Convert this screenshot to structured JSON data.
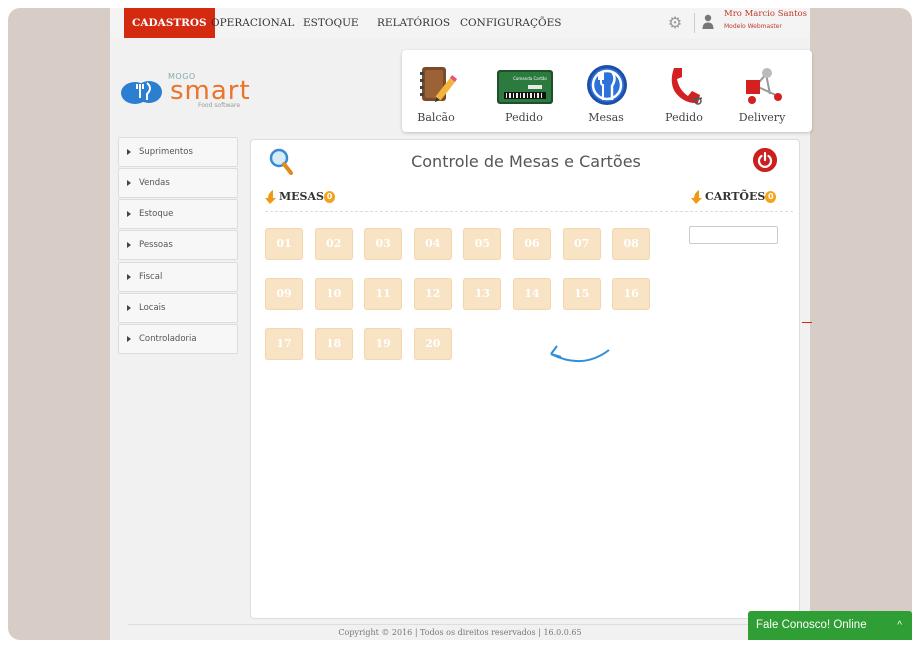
{
  "nav": {
    "items": [
      {
        "label": "CADASTROS",
        "active": true
      },
      {
        "label": "OPERACIONAL",
        "active": false
      },
      {
        "label": "ESTOQUE",
        "active": false
      },
      {
        "label": "RELATÓRIOS",
        "active": false
      },
      {
        "label": "CONFIGURAÇÕES",
        "active": false
      }
    ],
    "active_color": "#d42a0f"
  },
  "user": {
    "name": "Mro Marcio Santos",
    "role": "Modelo Webmaster"
  },
  "logo": {
    "mogo": "MOGO",
    "smart": "smart",
    "sub": "Food software"
  },
  "quick_actions": [
    {
      "label": "Balcão",
      "icon": "notebook-pencil-icon"
    },
    {
      "label": "Pedido",
      "icon": "card-icon",
      "card_text": "Comanda Cartão"
    },
    {
      "label": "Mesas",
      "icon": "fork-knife-icon"
    },
    {
      "label": "Pedido",
      "icon": "phone-icon"
    },
    {
      "label": "Delivery",
      "icon": "delivery-network-icon"
    }
  ],
  "sidebar": {
    "items": [
      {
        "label": "Suprimentos"
      },
      {
        "label": "Vendas"
      },
      {
        "label": "Estoque"
      },
      {
        "label": "Pessoas"
      },
      {
        "label": "Fiscal"
      },
      {
        "label": "Locais"
      },
      {
        "label": "Controladoria"
      }
    ]
  },
  "panel": {
    "title": "Controle de Mesas e Cartões",
    "mesas_label": "MESAS",
    "mesas_count": "0",
    "cartoes_label": "CARTÕES",
    "cartoes_count": "0",
    "tables": [
      "01",
      "02",
      "03",
      "04",
      "05",
      "06",
      "07",
      "08",
      "09",
      "10",
      "11",
      "12",
      "13",
      "14",
      "15",
      "16",
      "17",
      "18",
      "19",
      "20"
    ]
  },
  "footer": {
    "text": "Copyright © 2016 | Todos os direitos reservados | 16.0.0.65"
  },
  "chat": {
    "label": "Fale Conosco! Online",
    "caret": "^",
    "color": "#2f9e34"
  }
}
